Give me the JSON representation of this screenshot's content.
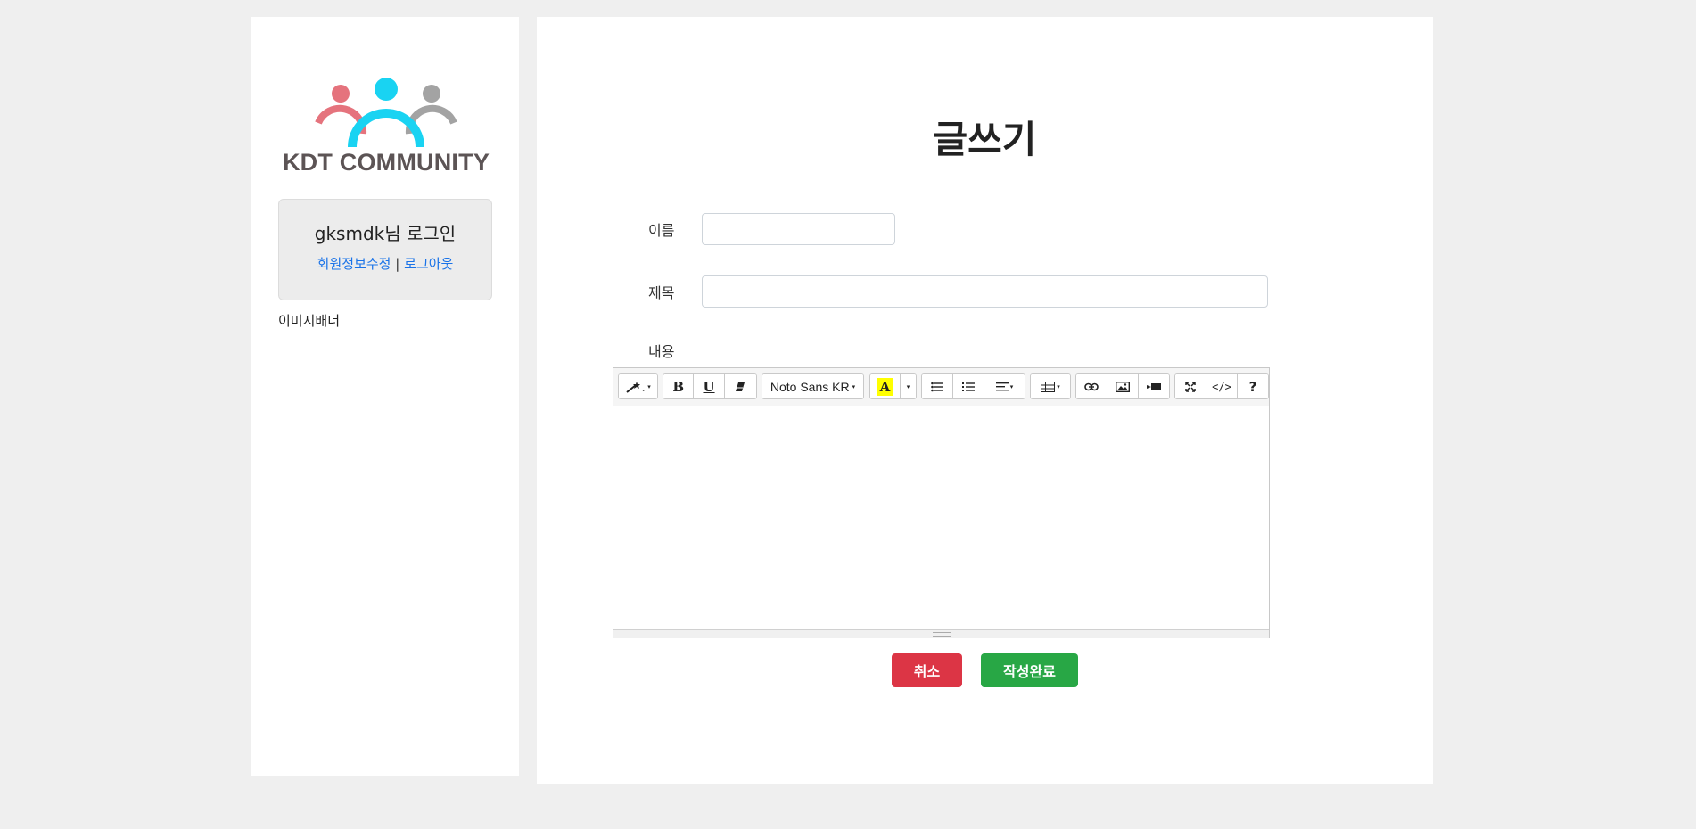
{
  "sidebar": {
    "logo_text": "KDT COMMUNITY",
    "login_greeting": "gksmdk님 로그인",
    "edit_profile_link": "회원정보수정",
    "separator": "|",
    "logout_link": "로그아웃",
    "banner_text": "이미지배너",
    "logo_colors": [
      "#e5737d",
      "#19d3f2",
      "#a3a3a3"
    ]
  },
  "main": {
    "title": "글쓰기",
    "form": {
      "name_label": "이름",
      "name_value": "",
      "subject_label": "제목",
      "subject_value": "",
      "content_label": "내용"
    },
    "toolbar": {
      "font_name": "Noto Sans KR",
      "icons": [
        "magic-icon",
        "bold-icon",
        "underline-icon",
        "eraser-icon",
        "font-dropdown",
        "highlight-color-icon",
        "color-dropdown",
        "unordered-list-icon",
        "ordered-list-icon",
        "align-icon",
        "table-icon",
        "link-icon",
        "picture-icon",
        "video-icon",
        "fullscreen-icon",
        "code-view-icon",
        "help-icon"
      ]
    },
    "buttons": {
      "cancel": "취소",
      "submit": "작성완료"
    }
  },
  "colors": {
    "cancel": "#dc3545",
    "submit": "#28a745",
    "link": "#1a73e8",
    "highlight": "#ffff00"
  }
}
